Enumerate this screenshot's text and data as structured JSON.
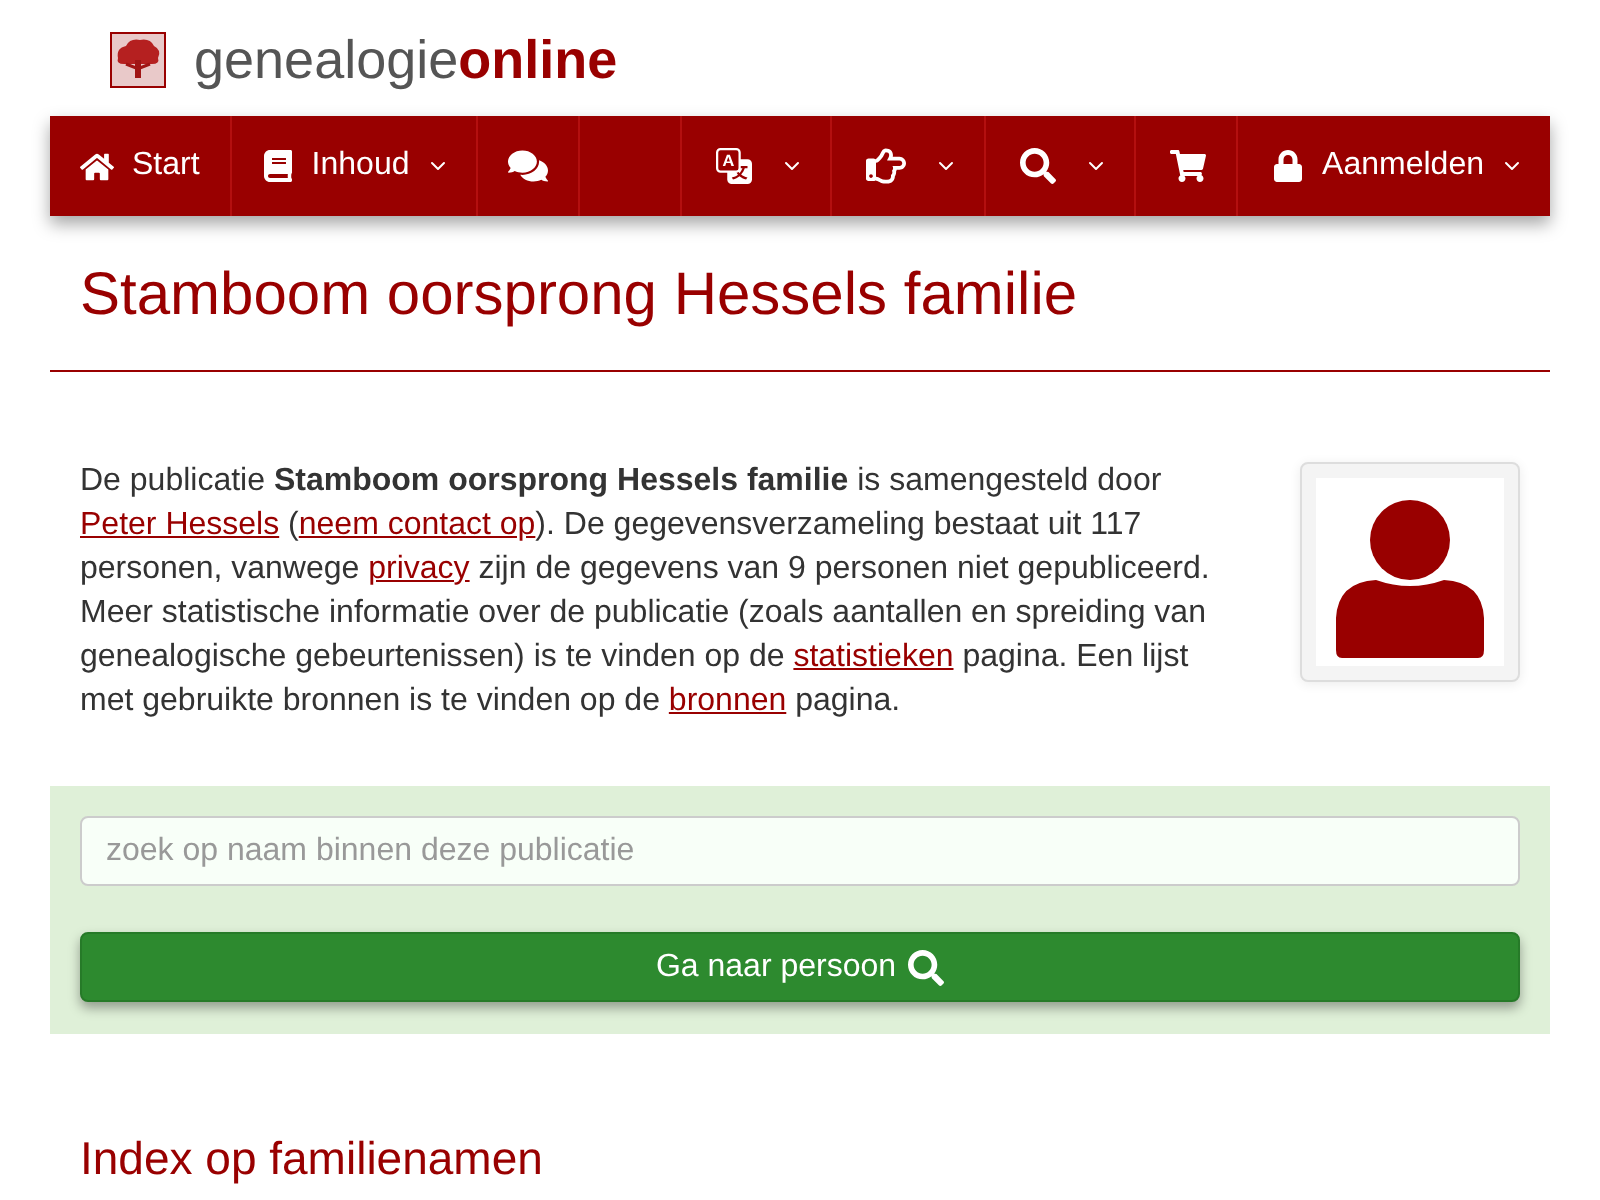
{
  "logo": {
    "text": "genealogie**online**"
  },
  "nav": {
    "left_items": [
      {
        "label": "Start",
        "dropdown": false
      },
      {
        "label": "Inhoud",
        "dropdown": true
      },
      {
        "dropdown": false
      }
    ],
    "right_items": [
      {
        "dropdown": true
      },
      {
        "dropdown": true
      },
      {
        "dropdown": true
      },
      {
        "dropdown": false
      },
      {
        "label": "Aanmelden",
        "dropdown": true
      }
    ]
  },
  "title": "Stamboom oorsprong Hessels familie",
  "intro": {
    "segments": [
      {
        "kind": "text",
        "text": "De publicatie **Stamboom oorsprong Hessels familie** is samengesteld door "
      },
      {
        "kind": "link",
        "text": "Peter Hessels"
      },
      {
        "kind": "text",
        "text": " ("
      },
      {
        "kind": "link",
        "text": "neem contact op"
      },
      {
        "kind": "text",
        "text": "). De gegevensverzameling bestaat uit 117 personen, vanwege "
      },
      {
        "kind": "link",
        "text": "privacy"
      },
      {
        "kind": "text",
        "text": " zijn de gegevens van 9 personen niet gepubliceerd. Meer statistische informatie over de publicatie (zoals aantallen en spreiding van genealogische gebeurtenissen) is te vinden op de "
      },
      {
        "kind": "link",
        "text": "statistieken"
      },
      {
        "kind": "text",
        "text": " pagina. Een lijst met gebruikte bronnen is te vinden op de "
      },
      {
        "kind": "link",
        "text": "bronnen"
      },
      {
        "kind": "text",
        "text": " pagina."
      }
    ]
  },
  "search": {
    "placeholder": "zoek op naam binnen deze publicatie",
    "button": "Ga naar persoon"
  },
  "section_heading": "Index op familienamen"
}
